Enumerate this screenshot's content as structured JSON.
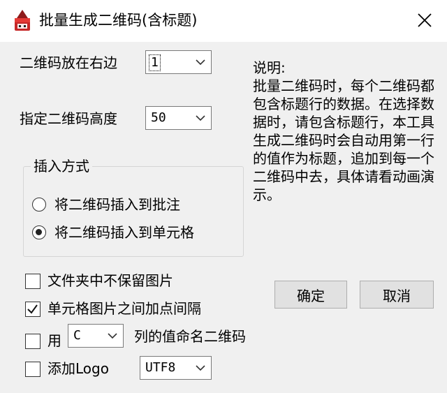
{
  "window": {
    "title": "批量生成二维码(含标题)",
    "icon": "app-qr-icon",
    "close_icon": "close-icon"
  },
  "position": {
    "label": "二维码放在右边",
    "selected": "1"
  },
  "height": {
    "label": "指定二维码高度",
    "selected": "50"
  },
  "insert_mode": {
    "title": "插入方式",
    "options": [
      {
        "label": "将二维码插入到批注",
        "checked": false
      },
      {
        "label": "将二维码插入到单元格",
        "checked": true
      }
    ]
  },
  "description": {
    "heading": "说明:",
    "text": "批量二维码时，每个二维码都包含标题行的数据。在选择数据时，请包含标题行，本工具生成二维码时会自动用第一行的值作为标题，追加到每一个二维码中去，具体请看动画演示。"
  },
  "options": {
    "no_keep_images": {
      "label": "文件夹中不保留图片",
      "checked": false
    },
    "add_spacing": {
      "label": "单元格图片之间加点间隔",
      "checked": true
    },
    "name_by_column": {
      "prefix": "用",
      "column": "C",
      "suffix": "列的值命名二维码",
      "checked": false
    },
    "add_logo": {
      "label": "添加Logo",
      "checked": false,
      "encoding": "UTF8"
    }
  },
  "buttons": {
    "ok": "确定",
    "cancel": "取消"
  }
}
